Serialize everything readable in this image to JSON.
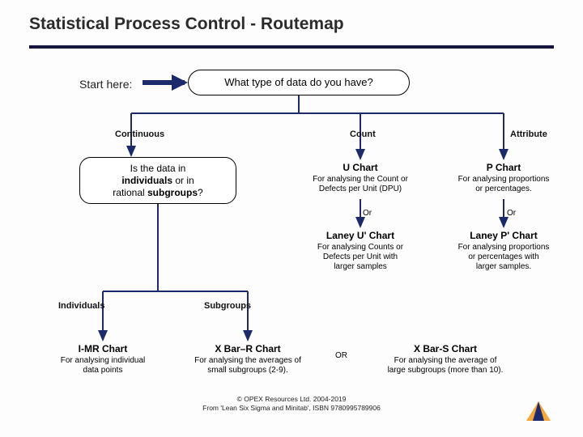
{
  "title": "Statistical Process Control - Routemap",
  "start_label": "Start here:",
  "q1": "What type of data do you have?",
  "branches": {
    "continuous": "Continuous",
    "count": "Count",
    "attribute": "Attribute"
  },
  "q2": {
    "l1": "Is the data in",
    "l2": "individuals or in",
    "l3": "rational subgroups?"
  },
  "branches2": {
    "individuals": "Individuals",
    "subgroups": "Subgroups"
  },
  "u_chart": {
    "hdr": "U Chart",
    "desc1": "For analysing the Count or",
    "desc2": "Defects per Unit (DPU)"
  },
  "p_chart": {
    "hdr": "P Chart",
    "desc1": "For analysing proportions",
    "desc2": "or percentages."
  },
  "or_label": "Or",
  "laney_u": {
    "hdr": "Laney U' Chart",
    "desc1": "For analysing Counts or",
    "desc2": "Defects per Unit with",
    "desc3": "larger samples"
  },
  "laney_p": {
    "hdr": "Laney P' Chart",
    "desc1": "For analysing proportions",
    "desc2": "or percentages with",
    "desc3": "larger samples."
  },
  "imr": {
    "hdr": "I-MR Chart",
    "desc1": "For analysing individual",
    "desc2": "data points"
  },
  "xbar_r": {
    "hdr": "X Bar–R Chart",
    "desc1": "For analysing the averages of",
    "desc2": "small subgroups (2-9)."
  },
  "or2": "OR",
  "xbar_s": {
    "hdr": "X Bar-S Chart",
    "desc1": "For analysing the average of",
    "desc2": "large subgroups (more than 10)."
  },
  "footer1": "© OPEX Resources Ltd. 2004-2019",
  "footer2": "From 'Lean Six Sigma and Minitab', ISBN 9780995789906"
}
